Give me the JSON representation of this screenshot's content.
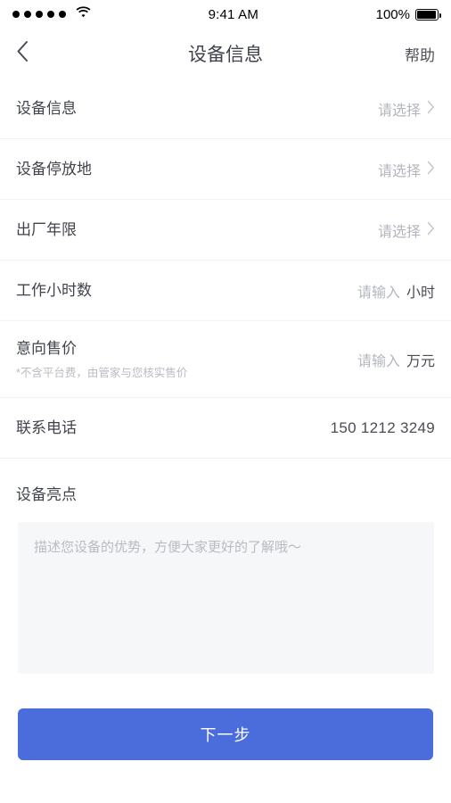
{
  "status_bar": {
    "signal_dots": 5,
    "wifi_icon": "wifi-icon",
    "time": "9:41 AM",
    "battery_percent": "100%",
    "battery_icon": "battery-full-icon"
  },
  "nav": {
    "back_icon": "chevron-left-icon",
    "title": "设备信息",
    "help_label": "帮助"
  },
  "colors": {
    "accent": "#4a6ddb",
    "label": "#40434c",
    "placeholder": "#b3b6be",
    "divider": "#f1f2f4",
    "textarea_bg": "#f6f7f8"
  },
  "form": {
    "rows": [
      {
        "label": "设备信息",
        "value": "请选择",
        "kind": "select",
        "chevron": "chevron-right-icon",
        "sub": "",
        "unit": ""
      },
      {
        "label": "设备停放地",
        "value": "请选择",
        "kind": "select",
        "chevron": "chevron-right-icon",
        "sub": "",
        "unit": ""
      },
      {
        "label": "出厂年限",
        "value": "请选择",
        "kind": "select",
        "chevron": "chevron-right-icon",
        "sub": "",
        "unit": ""
      },
      {
        "label": "工作小时数",
        "value": "请输入",
        "kind": "input",
        "chevron": "",
        "sub": "",
        "unit": "小时"
      },
      {
        "label": "意向售价",
        "value": "请输入",
        "kind": "input",
        "chevron": "",
        "sub": "*不含平台费，由管家与您核实售价",
        "unit": "万元"
      },
      {
        "label": "联系电话",
        "value": "150 1212 3249",
        "kind": "filled",
        "chevron": "",
        "sub": "",
        "unit": ""
      }
    ]
  },
  "highlights": {
    "title": "设备亮点",
    "placeholder": "描述您设备的优势，方便大家更好的了解哦～",
    "text": ""
  },
  "submit": {
    "label": "下一步"
  }
}
